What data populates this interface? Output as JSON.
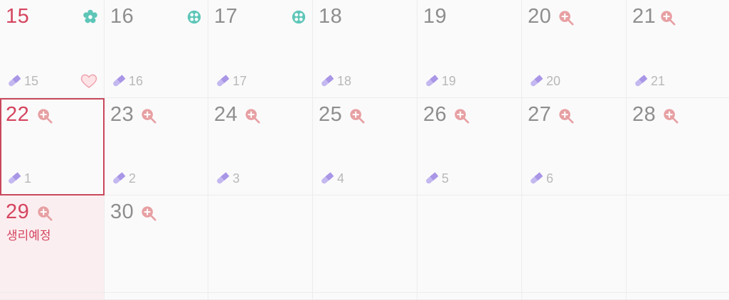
{
  "calendar": {
    "row1": {
      "days": [
        "15",
        "16",
        "17",
        "18",
        "19",
        "20",
        "21"
      ],
      "pills": [
        "15",
        "16",
        "17",
        "18",
        "19",
        "20",
        "21"
      ]
    },
    "row2": {
      "days": [
        "22",
        "23",
        "24",
        "25",
        "26",
        "27",
        "28"
      ],
      "pills": [
        "1",
        "2",
        "3",
        "4",
        "5",
        "6"
      ]
    },
    "row3": {
      "days": [
        "29",
        "30"
      ],
      "event": "생리예정"
    }
  },
  "colors": {
    "accent_red": "#d5455f",
    "teal": "#5ec6b8",
    "pill_purple": "#b3a4ea",
    "zoom_pink": "#e7a0a3"
  },
  "icons": {
    "ovulation_flower": "flower-icon",
    "fertile_dots": "fertile-dots-icon",
    "check_zoom": "zoom-plus-icon",
    "pill": "pill-icon",
    "heart": "heart-icon"
  }
}
